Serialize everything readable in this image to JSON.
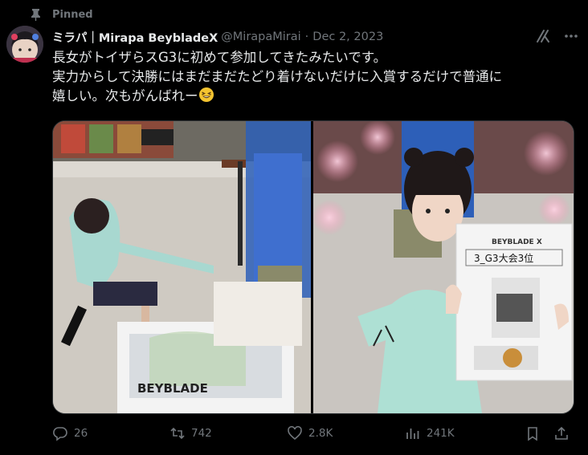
{
  "pinned": {
    "label": "Pinned"
  },
  "author": {
    "display_name": "ミラパ｜Mirapa BeybladeX",
    "handle": "@MirapaMirai",
    "separator": "·",
    "date": "Dec 2, 2023"
  },
  "tweet": {
    "lines": [
      "長女がトイザらスG3に初めて参加してきたみたいです。",
      "実力からして決勝にはまだまだたどり着けないだけに入賞するだけで普通に",
      "嬉しい。次もがんばれー"
    ],
    "emoji": "grinning-squinting-face"
  },
  "media": {
    "left_photo": {
      "signage": "BEYBLADE"
    },
    "right_photo": {
      "certificate_brand": "BEYBLADE X",
      "certificate_title": "3_G3大会3位"
    }
  },
  "actions": {
    "reply_count": "26",
    "repost_count": "742",
    "like_count": "2.8K",
    "view_count": "241K"
  },
  "colors": {
    "background": "#000000",
    "text_primary": "#e7e9ea",
    "text_secondary": "#71767b",
    "border": "#2f3336"
  }
}
